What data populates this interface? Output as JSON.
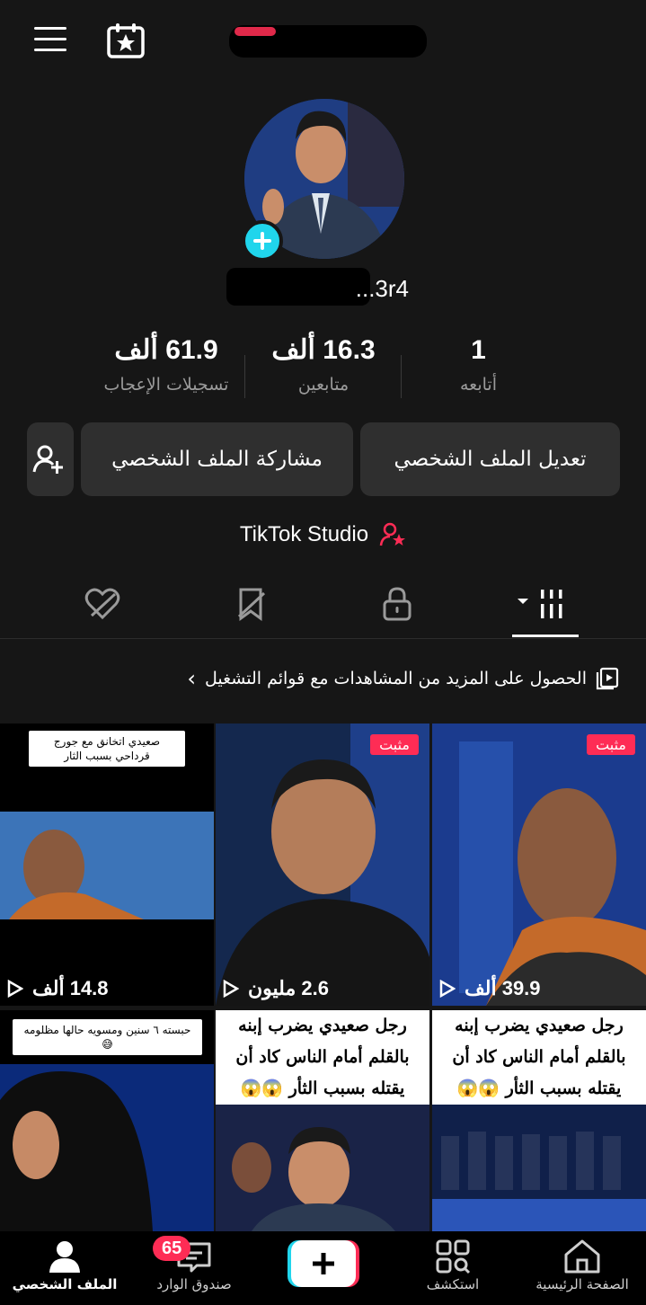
{
  "username": "...3r4",
  "stats": [
    {
      "value": "61.9 ألف",
      "label": "تسجيلات الإعجاب"
    },
    {
      "value": "16.3 ألف",
      "label": "متابعين"
    },
    {
      "value": "1",
      "label": "أتابعه"
    }
  ],
  "buttons": {
    "edit_profile": "تعديل الملف الشخصي",
    "share_profile": "مشاركة الملف الشخصي"
  },
  "studio_label": "TikTok Studio",
  "playlist_prompt": "الحصول على المزيد من المشاهدات مع قوائم التشغيل",
  "playlist_chevron": "›",
  "videos": [
    {
      "pinned": "مثبت",
      "views": "39.9 ألف"
    },
    {
      "pinned": "مثبت",
      "views": "2.6 مليون"
    },
    {
      "caption": "صعيدي اتخانق مع جورج قرداحي بسبب الثار",
      "views": "14.8 ألف"
    },
    {
      "overlay_lines": [
        "رجل صعيدي يضرب إبنه",
        "بالقلم أمام الناس كاد أن",
        "يقتله بسبب الثأر 😱😱"
      ]
    },
    {
      "overlay_lines": [
        "رجل صعيدي يضرب إبنه",
        "بالقلم أمام الناس كاد أن",
        "يقتله بسبب الثأر 😱😱"
      ]
    },
    {
      "caption": "حبسته ٦ سنين ومسويه حالها مظلومه 😅"
    }
  ],
  "nav": {
    "home": "الصفحة الرئيسية",
    "explore": "استكشف",
    "inbox": "صندوق الوارد",
    "inbox_badge": "65",
    "profile": "الملف الشخصي"
  },
  "colors": {
    "accent": "#fe2c55",
    "cyan": "#20d5ec",
    "background": "#161616"
  }
}
